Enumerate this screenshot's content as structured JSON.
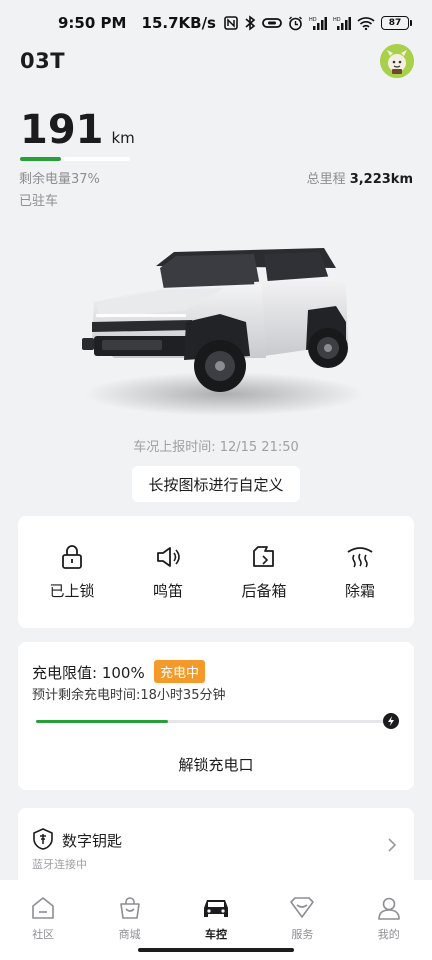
{
  "status_bar": {
    "time": "9:50 PM",
    "net_speed": "15.7KB/s",
    "battery_level": "87"
  },
  "vehicle": {
    "name": "03T"
  },
  "summary": {
    "range_value": "191",
    "range_unit": "km",
    "battery_fraction": 0.37,
    "soc_label": "剩余电量37%",
    "park_status": "已驻车",
    "odometer_label": "总里程",
    "odometer_value": "3,223km"
  },
  "report": {
    "time_text": "车况上报时间:  12/15 21:50"
  },
  "customize_label": "长按图标进行自定义",
  "controls": [
    {
      "label": "已上锁",
      "icon": "lock-icon"
    },
    {
      "label": "鸣笛",
      "icon": "horn-icon"
    },
    {
      "label": "后备箱",
      "icon": "trunk-icon"
    },
    {
      "label": "除霜",
      "icon": "defrost-icon"
    }
  ],
  "charging": {
    "limit_text": "充电限值: 100%",
    "badge": "充电中",
    "eta_text": "预计剩余充电时间:18小时35分钟",
    "progress_fraction": 0.38,
    "unlock_port_label": "解锁充电口"
  },
  "digital_key": {
    "title": "数字钥匙",
    "status": "蓝牙连接中"
  },
  "tabs": [
    {
      "label": "社区",
      "icon": "community-icon",
      "active": false
    },
    {
      "label": "商城",
      "icon": "shop-icon",
      "active": false
    },
    {
      "label": "车控",
      "icon": "car-control-icon",
      "active": true
    },
    {
      "label": "服务",
      "icon": "service-icon",
      "active": false
    },
    {
      "label": "我的",
      "icon": "profile-icon",
      "active": false
    }
  ],
  "colors": {
    "accent_green": "#27a03a",
    "badge_orange": "#f39a2b",
    "background": "#f1f2f4"
  }
}
